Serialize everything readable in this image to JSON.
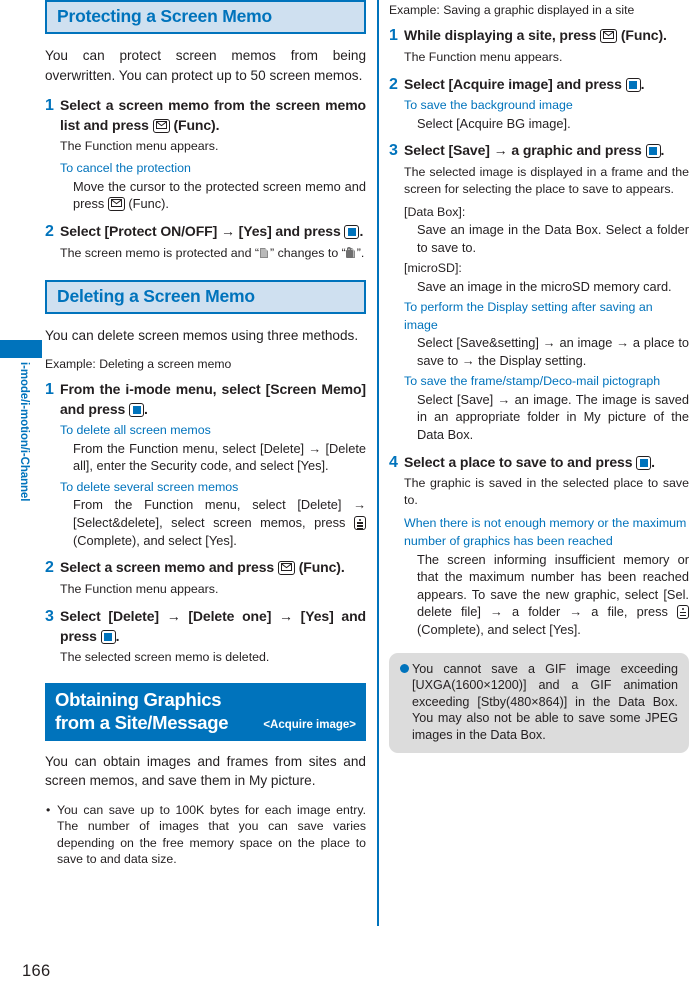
{
  "page": {
    "number": "166",
    "side_tab_label": "i-mode/i-motion/i-Channel"
  },
  "left_column": {
    "section_protect": {
      "heading": "Protecting a Screen Memo",
      "intro": "You can protect screen memos from being overwritten. You can protect up to 50 screen memos.",
      "steps": [
        {
          "number": "1",
          "head_a": "Select a screen memo from the screen memo list and press ",
          "head_icon": "mail-key-icon",
          "head_b": " (Func).",
          "result": "The Function menu appears.",
          "sub_heading": "To cancel the protection",
          "sub_body_a": "Move the cursor to the protected screen memo and press ",
          "sub_body_icon": "mail-key-icon",
          "sub_body_b": " (Func)."
        },
        {
          "number": "2",
          "head_a": "Select [Protect ON/OFF] ",
          "head_arrow": "→",
          "head_b": " [Yes] and press ",
          "head_icon": "center-key-icon",
          "head_c": ".",
          "result_a": "The screen memo is protected and “",
          "result_icon_1": "memo-unlocked-icon",
          "result_b": "” changes to “",
          "result_icon_2": "memo-locked-icon",
          "result_c": "”."
        }
      ]
    },
    "section_delete": {
      "heading": "Deleting a Screen Memo",
      "intro": "You can delete screen memos using three methods.",
      "example": "Example: Deleting a screen memo",
      "steps": [
        {
          "number": "1",
          "head_a": "From the i-mode menu, select [Screen Memo] and press ",
          "head_icon": "center-key-icon",
          "head_b": ".",
          "subs": [
            {
              "heading": "To delete all screen memos",
              "body_a": "From the Function menu, select [Delete] ",
              "arrow": "→",
              "body_b": " [Delete all], enter the Security code, and select [Yes]."
            },
            {
              "heading": "To delete several screen memos",
              "body_a": "From the Function menu, select [Delete] ",
              "arrow": "→",
              "body_b": " [Select&delete], select screen memos, press ",
              "body_icon": "memo-key-icon",
              "body_c": " (Complete), and select [Yes]."
            }
          ]
        },
        {
          "number": "2",
          "head_a": "Select a screen memo and press ",
          "head_icon": "mail-key-icon",
          "head_b": " (Func).",
          "result": "The Function menu appears."
        },
        {
          "number": "3",
          "head_a": "Select [Delete] ",
          "head_arrow_1": "→",
          "head_b": " [Delete one] ",
          "head_arrow_2": "→",
          "head_c": " [Yes] and press ",
          "head_icon": "center-key-icon",
          "head_d": ".",
          "result": "The selected screen memo is deleted."
        }
      ]
    },
    "section_obtain": {
      "heading": "Obtaining Graphics from a Site/Message",
      "heading_sub": "<Acquire image>",
      "intro": "You can obtain images and frames from sites and screen memos, and save them in My picture.",
      "bullet": "You can save up to 100K bytes for each image entry. The number of images that you can save varies depending on the free memory space on the place to save to and data size."
    }
  },
  "right_column": {
    "example": "Example: Saving a graphic displayed in a site",
    "steps": [
      {
        "number": "1",
        "head_a": "While displaying a site, press ",
        "head_icon": "mail-key-icon",
        "head_b": " (Func).",
        "result": "The Function menu appears."
      },
      {
        "number": "2",
        "head_a": "Select [Acquire image] and press ",
        "head_icon": "center-key-icon",
        "head_b": ".",
        "sub_heading": "To save the background image",
        "sub_body": "Select [Acquire BG image]."
      },
      {
        "number": "3",
        "head_a": "Select [Save] ",
        "head_arrow": "→",
        "head_b": " a graphic and press ",
        "head_icon": "center-key-icon",
        "head_c": ".",
        "result": "The selected image is displayed in a frame and the screen for selecting the place to save to appears.",
        "label_databox": "[Data Box]:",
        "body_databox": "Save an image in the Data Box. Select a folder to save to.",
        "label_microsd": "[microSD]:",
        "body_microsd": "Save an image in the microSD memory card.",
        "sub_display_heading": "To perform the Display setting after saving an image",
        "sub_display_body_a": "Select [Save&setting] ",
        "sub_display_arrow_1": "→",
        "sub_display_body_b": " an image ",
        "sub_display_arrow_2": "→",
        "sub_display_body_c": " a place to save to ",
        "sub_display_arrow_3": "→",
        "sub_display_body_d": " the Display setting.",
        "sub_frame_heading": "To save the frame/stamp/Deco-mail pictograph",
        "sub_frame_body_a": "Select [Save] ",
        "sub_frame_arrow": "→",
        "sub_frame_body_b": " an image. The image is saved in an appropriate folder in My picture of the Data Box."
      },
      {
        "number": "4",
        "head_a": "Select a place to save to and press ",
        "head_icon": "center-key-icon",
        "head_b": ".",
        "result": "The graphic is saved in the selected place to save to.",
        "sub_heading_line1": "When there is not enough memory or the maximum",
        "sub_heading_line2": "number of graphics has been reached",
        "sub_body_a": "The screen informing insufficient memory or that the maximum number has been reached appears. To save the new graphic, select [Sel. delete file] ",
        "sub_body_arrow_1": "→",
        "sub_body_b": " a folder ",
        "sub_body_arrow_2": "→",
        "sub_body_c": " a file, press ",
        "sub_body_icon": "memo-key-icon",
        "sub_body_d": " (Complete), and select [Yes]."
      }
    ],
    "note": {
      "bullet_icon": "blue-dot-icon",
      "text": "You cannot save a GIF image exceeding [UXGA(1600×1200)] and a GIF animation exceeding [Stby(480×864)] in the Data Box. You may also not be able to save some JPEG images in the Data Box."
    }
  },
  "colors": {
    "brand_blue": "#0073bc",
    "heading_fill": "#cfe0f0",
    "note_bg": "#dcdcdc",
    "text": "#231f20"
  }
}
